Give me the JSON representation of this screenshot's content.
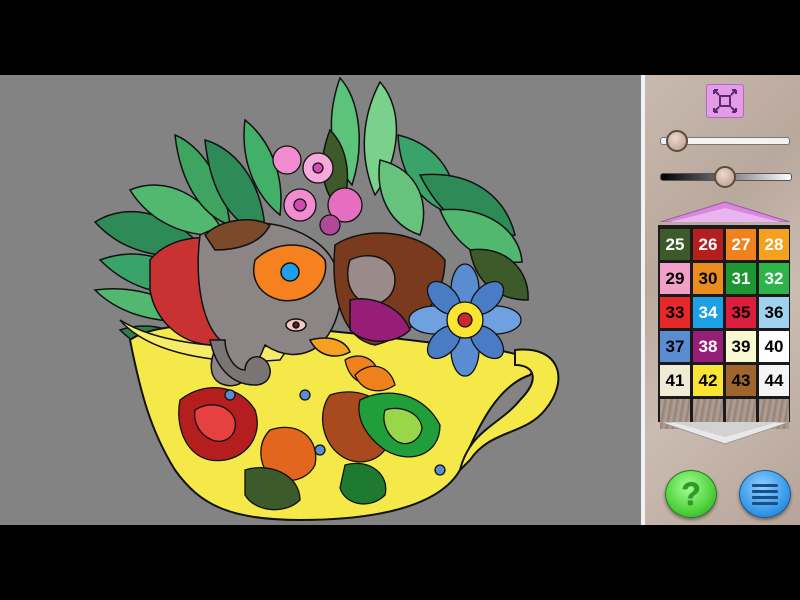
{
  "canvas": {
    "background": "#838383"
  },
  "toolbar": {
    "fit_icon": "fit-screen-icon"
  },
  "sliders": [
    {
      "name": "zoom-slider",
      "level": 0.05
    },
    {
      "name": "brightness-slider",
      "level": 0.48
    }
  ],
  "palette": {
    "up_icon": "triangle-up-icon",
    "down_icon": "triangle-down-icon",
    "swatches": [
      {
        "number": "25",
        "color": "#3c5a2a",
        "text_color": "#ffffff"
      },
      {
        "number": "26",
        "color": "#b41e1e",
        "text_color": "#ffffff"
      },
      {
        "number": "27",
        "color": "#f0821e",
        "text_color": "#ffffff"
      },
      {
        "number": "28",
        "color": "#f5a01e",
        "text_color": "#ffffff"
      },
      {
        "number": "29",
        "color": "#f2a0c8",
        "text_color": "#000000"
      },
      {
        "number": "30",
        "color": "#eb8c1e",
        "text_color": "#000000"
      },
      {
        "number": "31",
        "color": "#1e9632",
        "text_color": "#ffffff"
      },
      {
        "number": "32",
        "color": "#2db44b",
        "text_color": "#ffffff"
      },
      {
        "number": "33",
        "color": "#e62828",
        "text_color": "#000000"
      },
      {
        "number": "34",
        "color": "#1ea0e6",
        "text_color": "#ffffff"
      },
      {
        "number": "35",
        "color": "#dc1e3c",
        "text_color": "#000000"
      },
      {
        "number": "36",
        "color": "#a0d2f0",
        "text_color": "#000000"
      },
      {
        "number": "37",
        "color": "#5a8cd2",
        "text_color": "#000000"
      },
      {
        "number": "38",
        "color": "#961e78",
        "text_color": "#ffffff"
      },
      {
        "number": "39",
        "color": "#fafad2",
        "text_color": "#000000"
      },
      {
        "number": "40",
        "color": "#ffffff",
        "text_color": "#000000"
      },
      {
        "number": "41",
        "color": "#f0ebd7",
        "text_color": "#000000"
      },
      {
        "number": "42",
        "color": "#fae632",
        "text_color": "#000000"
      },
      {
        "number": "43",
        "color": "#a0642d",
        "text_color": "#000000"
      },
      {
        "number": "44",
        "color": "#f5f5f5",
        "text_color": "#000000"
      }
    ]
  },
  "buttons": {
    "help_label": "?",
    "help_icon": "help-icon",
    "menu_icon": "menu-icon"
  }
}
